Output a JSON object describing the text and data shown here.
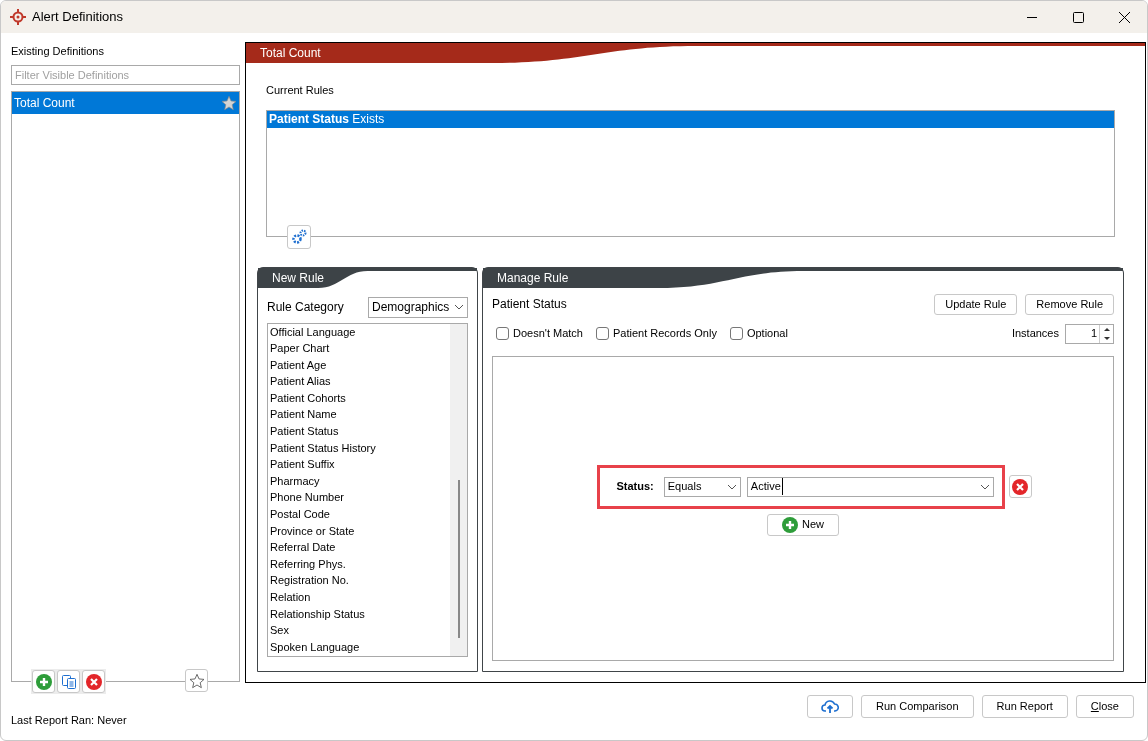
{
  "window": {
    "title": "Alert Definitions"
  },
  "sidebar": {
    "heading": "Existing Definitions",
    "filter": {
      "placeholder": "Filter Visible Definitions"
    },
    "definitions": [
      {
        "label": "Total Count",
        "selected": true
      }
    ],
    "last_report": "Last Report Ran: Never"
  },
  "definition": {
    "title": "Total Count",
    "current_rules_label": "Current Rules",
    "rules": [
      {
        "text": "**Patient Status** Exists",
        "selected": true
      }
    ]
  },
  "new_rule": {
    "title": "New Rule",
    "category_label": "Rule Category",
    "category": "Demographics",
    "items": [
      "Official Language",
      "Paper Chart",
      "Patient Age",
      "Patient Alias",
      "Patient Cohorts",
      "Patient Name",
      "Patient Status",
      "Patient Status History",
      "Patient Suffix",
      "Pharmacy",
      "Phone Number",
      "Postal Code",
      "Province or State",
      "Referral Date",
      "Referring Phys.",
      "Registration No.",
      "Relation",
      "Relationship Status",
      "Sex",
      "Spoken Language"
    ]
  },
  "manage_rule": {
    "title": "Manage Rule",
    "rule_name": "Patient Status",
    "buttons": [
      "Update Rule",
      "Remove Rule"
    ],
    "options": [
      {
        "label": "Doesn't Match",
        "checked": false
      },
      {
        "label": "Patient Records Only",
        "checked": false
      },
      {
        "label": "Optional",
        "checked": false
      }
    ],
    "instances_label": "Instances",
    "instances": "1",
    "condition": {
      "label": "Status:",
      "operator": "Equals",
      "value": "Active",
      "highlighted": true
    },
    "new_button": "New"
  },
  "footer": {
    "buttons": [
      {
        "label": "Run Comparison",
        "underline_first": false
      },
      {
        "label": "Run Report",
        "underline_first": false
      },
      {
        "label": "Close",
        "underline_first": true
      }
    ]
  }
}
